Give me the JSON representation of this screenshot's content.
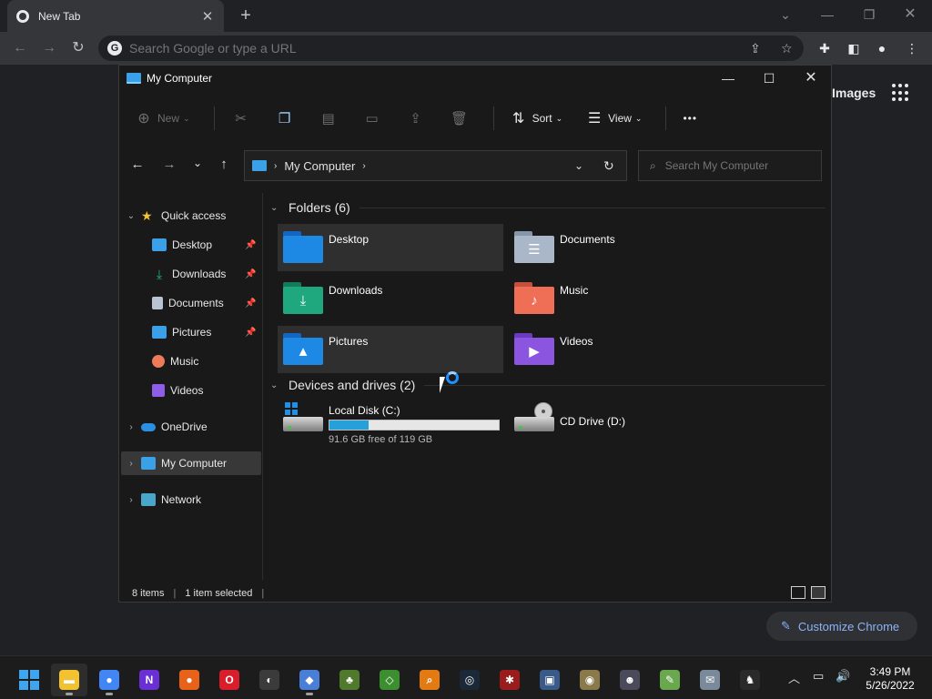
{
  "chrome": {
    "tab_title": "New Tab",
    "tab_close": "✕",
    "new_tab": "+",
    "omnibox_placeholder": "Search Google or type a URL",
    "google_images": "Images",
    "customize_label": "Customize Chrome"
  },
  "explorer": {
    "title": "My Computer",
    "commands": {
      "new_label": "New",
      "sort_label": "Sort",
      "view_label": "View",
      "more": "•••"
    },
    "address": {
      "location": "My Computer"
    },
    "search_placeholder": "Search My Computer",
    "nav_pane": {
      "quick_access": "Quick access",
      "pinned": [
        {
          "label": "Desktop",
          "color": "#3aa0e8"
        },
        {
          "label": "Downloads",
          "color": "#27b08a"
        },
        {
          "label": "Documents",
          "color": "#b9c4d2"
        },
        {
          "label": "Pictures",
          "color": "#3aa0e8"
        },
        {
          "label": "Music",
          "color": "#ef7a5a"
        },
        {
          "label": "Videos",
          "color": "#8f5ee8"
        }
      ],
      "onedrive": "OneDrive",
      "my_computer": "My Computer",
      "network": "Network"
    },
    "content": {
      "folders_header": "Folders (6)",
      "folders": [
        {
          "label": "Desktop",
          "color": "#1e88e5",
          "glyph": ""
        },
        {
          "label": "Documents",
          "color": "#aab7c8",
          "glyph": "☰"
        },
        {
          "label": "Downloads",
          "color": "#1fa87e",
          "glyph": "⤓"
        },
        {
          "label": "Music",
          "color": "#ee6f55",
          "glyph": "♪"
        },
        {
          "label": "Pictures",
          "color": "#1e88e5",
          "glyph": "▲"
        },
        {
          "label": "Videos",
          "color": "#8b55e0",
          "glyph": "▶"
        }
      ],
      "drives_header": "Devices and drives (2)",
      "drives": [
        {
          "label": "Local Disk (C:)",
          "free_text": "91.6 GB free of 119 GB",
          "used_fraction": 0.23
        },
        {
          "label": "CD Drive (D:)"
        }
      ]
    },
    "status": {
      "items": "8 items",
      "selected": "1 item selected"
    }
  },
  "taskbar": {
    "apps": [
      {
        "name": "file-explorer",
        "color": "#f2c230",
        "glyph": "▬"
      },
      {
        "name": "chrome",
        "color": "#4285f4",
        "glyph": "●"
      },
      {
        "name": "notion-like",
        "color": "#6b2fd6",
        "glyph": "N"
      },
      {
        "name": "firefox",
        "color": "#e8621a",
        "glyph": "●"
      },
      {
        "name": "opera",
        "color": "#d91d2b",
        "glyph": "O"
      },
      {
        "name": "obs",
        "color": "#3b3b3b",
        "glyph": "◐"
      },
      {
        "name": "app-blue",
        "color": "#4a7fd8",
        "glyph": "◆"
      },
      {
        "name": "app-tree",
        "color": "#4f7a2c",
        "glyph": "♣"
      },
      {
        "name": "app-green",
        "color": "#3b8f2e",
        "glyph": "◇"
      },
      {
        "name": "app-search",
        "color": "#e47b12",
        "glyph": "⌕"
      },
      {
        "name": "steam",
        "color": "#1b2838",
        "glyph": "◎"
      },
      {
        "name": "app-red",
        "color": "#9b1c1c",
        "glyph": "✱"
      },
      {
        "name": "app-network",
        "color": "#3a5a8a",
        "glyph": "▣"
      },
      {
        "name": "app-disc",
        "color": "#8a7a4a",
        "glyph": "◉"
      },
      {
        "name": "app-skull",
        "color": "#4a4a5a",
        "glyph": "☻"
      },
      {
        "name": "app-notepad",
        "color": "#6aa84f",
        "glyph": "✎"
      },
      {
        "name": "app-mail",
        "color": "#7a8a9a",
        "glyph": "✉"
      },
      {
        "name": "app-fox",
        "color": "#2a2a2a",
        "glyph": "♞"
      }
    ],
    "time": "3:49 PM",
    "date": "5/26/2022"
  }
}
